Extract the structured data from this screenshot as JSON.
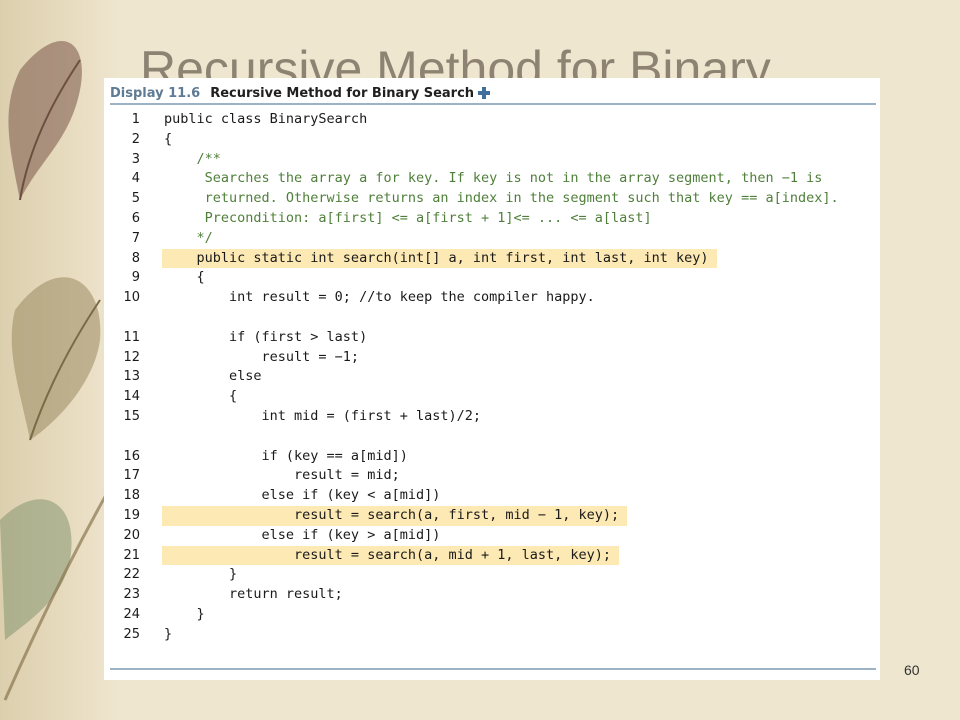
{
  "slide": {
    "title": "Recursive Method for Binary",
    "page_number": "60"
  },
  "display": {
    "label": "Display 11.6",
    "title": "Recursive Method for Binary Search"
  },
  "code_lines": [
    {
      "n": "1",
      "text": "public class BinarySearch"
    },
    {
      "n": "2",
      "text": "{"
    },
    {
      "n": "3",
      "text": "    /**"
    },
    {
      "n": "4",
      "text": "     Searches the array a for key. If key is not in the array segment, then −1 is"
    },
    {
      "n": "5",
      "text": "     returned. Otherwise returns an index in the segment such that key == a[index]."
    },
    {
      "n": "6",
      "text": "     Precondition: a[first] <= a[first + 1]<= ... <= a[last]"
    },
    {
      "n": "7",
      "text": "    */"
    },
    {
      "n": "8",
      "text": "    public static int search(int[] a, int first, int last, int key)"
    },
    {
      "n": "9",
      "text": "    {"
    },
    {
      "n": "10",
      "text": "        int result = 0; //to keep the compiler happy."
    },
    {
      "n": "11",
      "text": "        if (first > last)"
    },
    {
      "n": "12",
      "text": "            result = −1;"
    },
    {
      "n": "13",
      "text": "        else"
    },
    {
      "n": "14",
      "text": "        {"
    },
    {
      "n": "15",
      "text": "            int mid = (first + last)/2;"
    },
    {
      "n": "16",
      "text": "            if (key == a[mid])"
    },
    {
      "n": "17",
      "text": "                result = mid;"
    },
    {
      "n": "18",
      "text": "            else if (key < a[mid])"
    },
    {
      "n": "19",
      "text": "                result = search(a, first, mid − 1, key);"
    },
    {
      "n": "20",
      "text": "            else if (key > a[mid])"
    },
    {
      "n": "21",
      "text": "                result = search(a, mid + 1, last, key);"
    },
    {
      "n": "22",
      "text": "        }"
    },
    {
      "n": "23",
      "text": "        return result;"
    },
    {
      "n": "24",
      "text": "    }"
    },
    {
      "n": "25",
      "text": "}"
    }
  ],
  "colors": {
    "highlight": "#fde9b3",
    "keyword": "#1f5c8a",
    "comment": "#4f7f3a",
    "rule": "#9cb2c5"
  }
}
